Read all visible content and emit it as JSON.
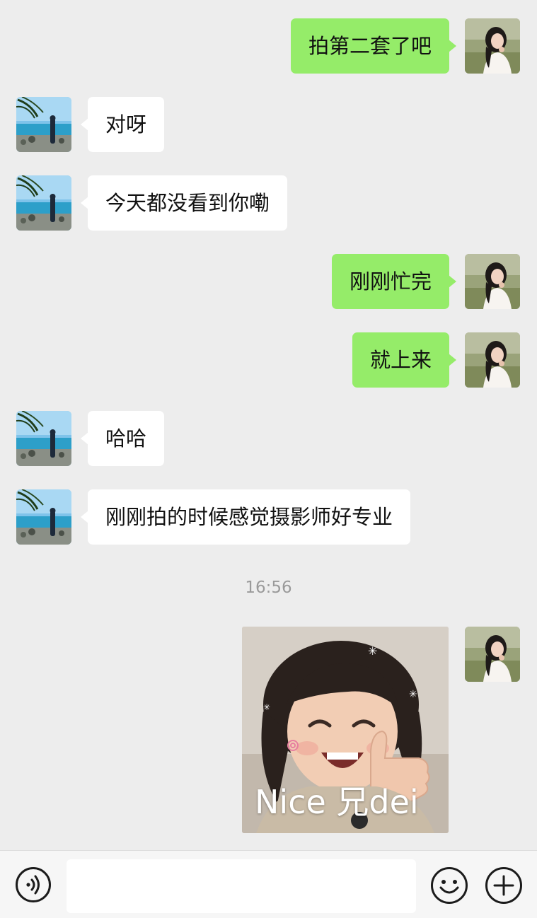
{
  "messages": [
    {
      "sender": "self",
      "text": "拍第二套了吧"
    },
    {
      "sender": "other",
      "text": "对呀"
    },
    {
      "sender": "other",
      "text": "今天都没看到你嘞"
    },
    {
      "sender": "self",
      "text": "刚刚忙完"
    },
    {
      "sender": "self",
      "text": "就上来"
    },
    {
      "sender": "other",
      "text": "哈哈"
    },
    {
      "sender": "other",
      "text": "刚刚拍的时候感觉摄影师好专业"
    }
  ],
  "timestamp": "16:56",
  "sticker": {
    "sender": "self",
    "caption": "Nice 兄dei"
  },
  "input_bar": {
    "voice_icon": "voice-icon",
    "text_value": "",
    "emoji_icon": "emoji-icon",
    "plus_icon": "plus-icon"
  },
  "colors": {
    "background": "#ededed",
    "self_bubble": "#95ec69",
    "other_bubble": "#ffffff",
    "timestamp": "#9a9a9a"
  }
}
